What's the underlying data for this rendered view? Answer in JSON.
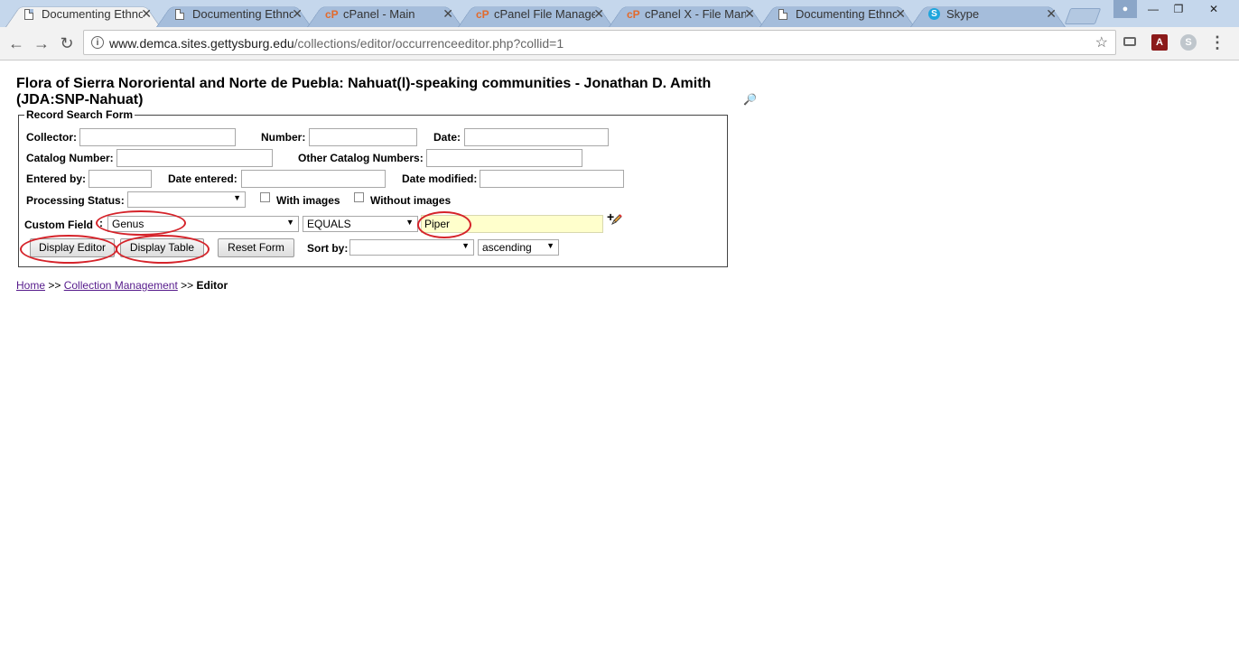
{
  "browser": {
    "tabs": [
      {
        "title": "Documenting Ethno",
        "icon": "document-icon"
      },
      {
        "title": "Documenting Ethnob",
        "icon": "document-icon"
      },
      {
        "title": "cPanel - Main",
        "icon": "cpanel-icon"
      },
      {
        "title": "cPanel File Manager",
        "icon": "cpanel-icon"
      },
      {
        "title": "cPanel X - File Mana",
        "icon": "cpanel-icon"
      },
      {
        "title": "Documenting Ethno",
        "icon": "document-icon"
      },
      {
        "title": "Skype",
        "icon": "skype-icon"
      }
    ],
    "url_host": "www.demca.sites.gettysburg.edu",
    "url_path": "/collections/editor/occurrenceeditor.php?collid=1"
  },
  "page": {
    "title": "Flora of Sierra Nororiental and Norte de Puebla: Nahuat(l)-speaking communities - Jonathan D. Amith (JDA:SNP-Nahuat)"
  },
  "form": {
    "legend": "Record Search Form",
    "collector_label": "Collector:",
    "collector_value": "",
    "number_label": "Number:",
    "number_value": "",
    "date_label": "Date:",
    "date_value": "",
    "catalog_label": "Catalog Number:",
    "catalog_value": "",
    "other_catalog_label": "Other Catalog Numbers:",
    "other_catalog_value": "",
    "entered_by_label": "Entered by:",
    "entered_by_value": "",
    "date_entered_label": "Date entered:",
    "date_entered_value": "",
    "date_modified_label": "Date modified:",
    "date_modified_value": "",
    "processing_label": "Processing Status:",
    "processing_value": "",
    "with_images_label": "With images",
    "without_images_label": "Without images",
    "custom_field_label": "Custom Field",
    "custom_field_value": "Genus",
    "operator_value": "EQUALS",
    "custom_value": "Piper",
    "display_editor_label": "Display Editor",
    "display_table_label": "Display Table",
    "reset_label": "Reset Form",
    "sort_label": "Sort by:",
    "sort_value": "",
    "order_value": "ascending"
  },
  "breadcrumb": {
    "home": "Home",
    "sep1": ">>",
    "collection_management": "Collection Management",
    "sep2": ">>",
    "current": "Editor"
  },
  "colors": {
    "annotation_circle": "#d5232a",
    "custom_value_bg": "#ffffcc",
    "link": "#551a8b"
  }
}
